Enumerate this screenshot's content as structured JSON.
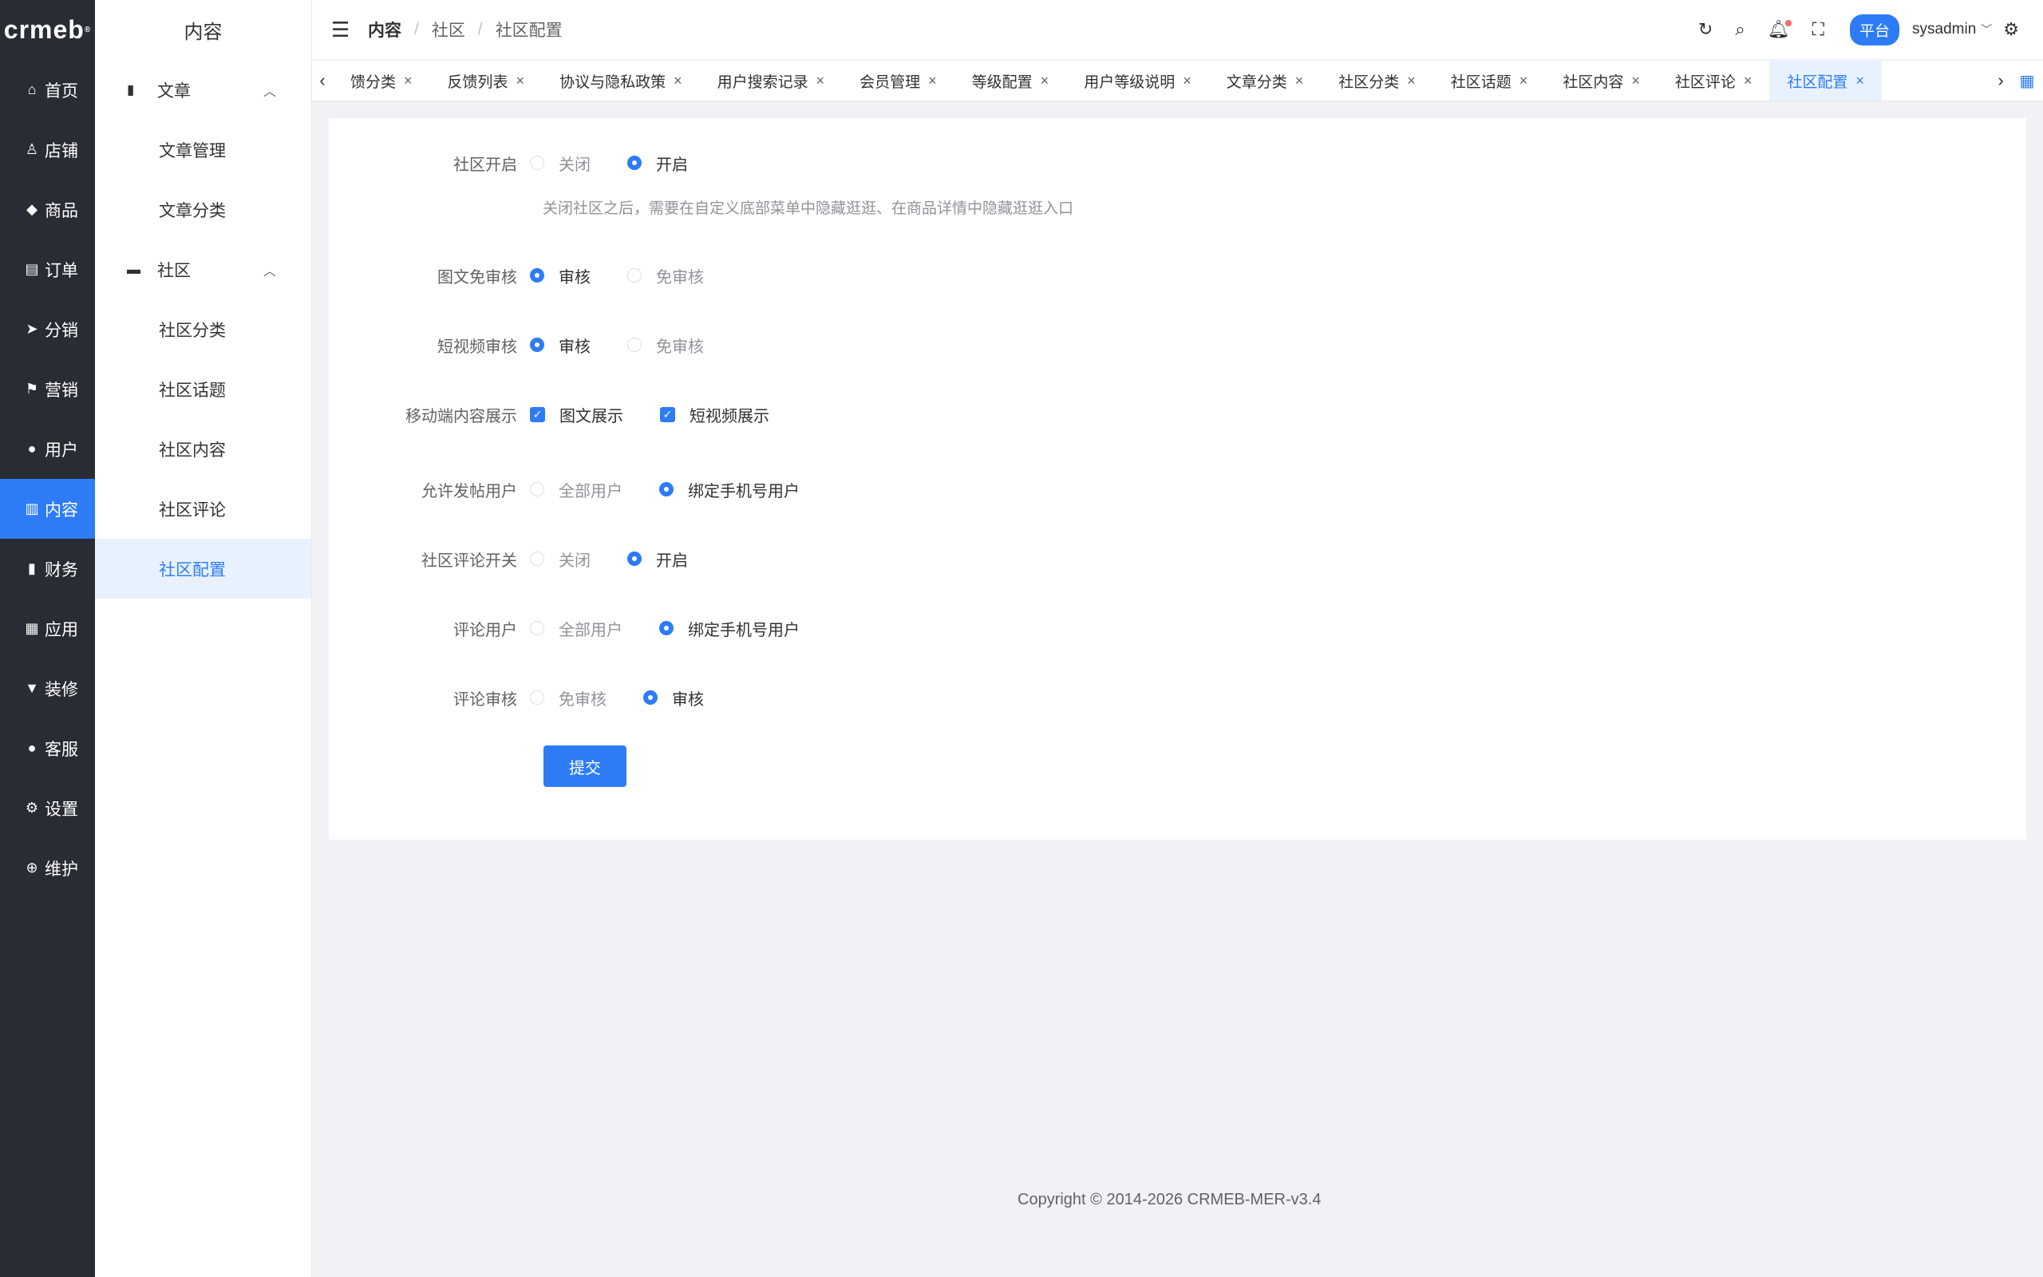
{
  "app": {
    "logo": "crmeb",
    "logo_mark": "®"
  },
  "nav_main": [
    {
      "label": "首页",
      "icon": "home-icon",
      "glyph": "⌂"
    },
    {
      "label": "店铺",
      "icon": "store-icon",
      "glyph": "♙"
    },
    {
      "label": "商品",
      "icon": "bag-icon",
      "glyph": "◆"
    },
    {
      "label": "订单",
      "icon": "clipboard-icon",
      "glyph": "▤"
    },
    {
      "label": "分销",
      "icon": "send-icon",
      "glyph": "➤"
    },
    {
      "label": "营销",
      "icon": "flag-icon",
      "glyph": "⚑"
    },
    {
      "label": "用户",
      "icon": "user-icon",
      "glyph": "●"
    },
    {
      "label": "内容",
      "icon": "content-icon",
      "glyph": "▥",
      "active": true
    },
    {
      "label": "财务",
      "icon": "chart-icon",
      "glyph": "▮"
    },
    {
      "label": "应用",
      "icon": "grid-icon",
      "glyph": "▦"
    },
    {
      "label": "装修",
      "icon": "brush-icon",
      "glyph": "▼"
    },
    {
      "label": "客服",
      "icon": "service-icon",
      "glyph": "●"
    },
    {
      "label": "设置",
      "icon": "gear-icon",
      "glyph": "⚙"
    },
    {
      "label": "维护",
      "icon": "plus-circle-icon",
      "glyph": "⊕"
    }
  ],
  "nav_sub": {
    "title": "内容",
    "groups": [
      {
        "label": "文章",
        "items": [
          "文章管理",
          "文章分类"
        ]
      },
      {
        "label": "社区",
        "items": [
          "社区分类",
          "社区话题",
          "社区内容",
          "社区评论",
          "社区配置"
        ]
      }
    ],
    "active_item": "社区配置"
  },
  "header": {
    "breadcrumb": [
      "内容",
      "社区",
      "社区配置"
    ],
    "sep": "/",
    "platform_label": "平台",
    "username": "sysadmin"
  },
  "tabs": {
    "items": [
      "馈分类",
      "反馈列表",
      "协议与隐私政策",
      "用户搜索记录",
      "会员管理",
      "等级配置",
      "用户等级说明",
      "文章分类",
      "社区分类",
      "社区话题",
      "社区内容",
      "社区评论",
      "社区配置"
    ],
    "active": "社区配置"
  },
  "form": {
    "community_open": {
      "label": "社区开启",
      "options": [
        "关闭",
        "开启"
      ],
      "selected": 1,
      "help": "关闭社区之后，需要在自定义底部菜单中隐藏逛逛、在商品详情中隐藏逛逛入口"
    },
    "post_audit": {
      "label": "图文免审核",
      "options": [
        "审核",
        "免审核"
      ],
      "selected": 0
    },
    "video_audit": {
      "label": "短视频审核",
      "options": [
        "审核",
        "免审核"
      ],
      "selected": 0
    },
    "mobile_display": {
      "label": "移动端内容展示",
      "options": [
        "图文展示",
        "短视频展示"
      ]
    },
    "post_users": {
      "label": "允许发帖用户",
      "options": [
        "全部用户",
        "绑定手机号用户"
      ],
      "selected": 1
    },
    "comment_switch": {
      "label": "社区评论开关",
      "options": [
        "关闭",
        "开启"
      ],
      "selected": 1
    },
    "comment_users": {
      "label": "评论用户",
      "options": [
        "全部用户",
        "绑定手机号用户"
      ],
      "selected": 1
    },
    "comment_audit": {
      "label": "评论审核",
      "options": [
        "免审核",
        "审核"
      ],
      "selected": 1
    },
    "submit_label": "提交"
  },
  "footer": {
    "copyright": "Copyright © 2014-2026 CRMEB-MER-v3.4"
  },
  "colors": {
    "primary": "#2d7cf6",
    "sidebar": "#282c34"
  }
}
